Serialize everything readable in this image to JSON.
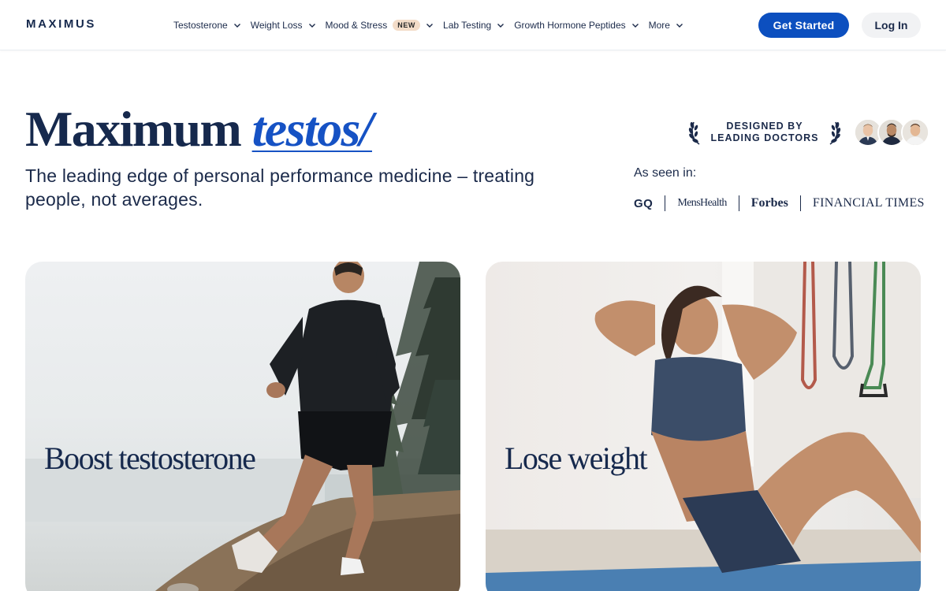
{
  "header": {
    "logo": "MAXIMUS",
    "nav": [
      {
        "label": "Testosterone",
        "badge": ""
      },
      {
        "label": "Weight Loss",
        "badge": ""
      },
      {
        "label": "Mood & Stress",
        "badge": "NEW"
      },
      {
        "label": "Lab Testing",
        "badge": ""
      },
      {
        "label": "Growth Hormone Peptides",
        "badge": ""
      },
      {
        "label": "More",
        "badge": ""
      }
    ],
    "get_started": "Get Started",
    "log_in": "Log In"
  },
  "hero": {
    "title_main": "Maximum ",
    "title_accent": "testos/",
    "subtitle": "The leading edge of personal performance medicine – treating people, not averages.",
    "designed_line1": "DESIGNED BY",
    "designed_line2": "LEADING DOCTORS",
    "seen_in": "As seen in:",
    "press": [
      "GQ",
      "MensHealth",
      "Forbes",
      "FINANCIAL TIMES"
    ]
  },
  "cards": [
    {
      "title": "Boost testosterone",
      "image": "man-running-trail-photo"
    },
    {
      "title": "Lose weight",
      "image": "woman-doing-situps-photo"
    }
  ],
  "colors": {
    "brand_navy": "#16294d",
    "accent_blue": "#0c4fbf",
    "badge_bg": "#f3dcc8"
  }
}
